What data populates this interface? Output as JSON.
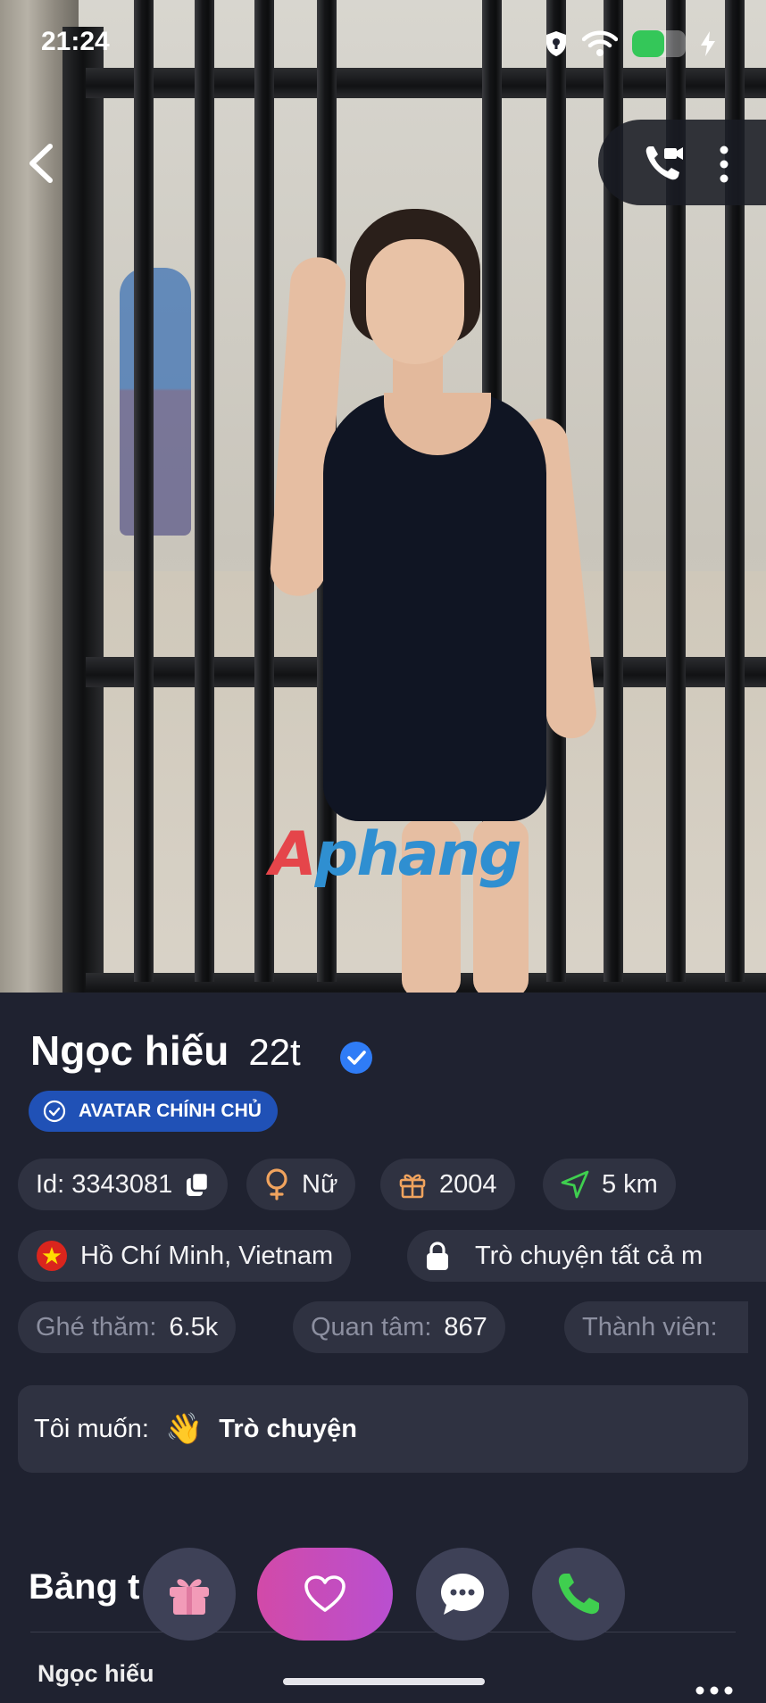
{
  "status_bar": {
    "time": "21:24",
    "battery_level": 0.6
  },
  "photo": {
    "watermark_part1": "A",
    "watermark_part2": "phang"
  },
  "profile": {
    "name": "Ngọc hiếu",
    "age": "22t",
    "badge_label": "AVATAR CHÍNH CHỦ"
  },
  "chips": {
    "id_label": "Id: 3343081",
    "gender": "Nữ",
    "birth_year": "2004",
    "distance": "5 km",
    "location": "Hồ Chí Minh, Vietnam",
    "chat_setting": "Trò chuyện tất cả m"
  },
  "stats": {
    "visits_label": "Ghé thăm:",
    "visits_value": "6.5k",
    "interest_label": "Quan tâm:",
    "interest_value": "867",
    "members_label": "Thành viên:"
  },
  "want": {
    "label": "Tôi muốn:",
    "emoji": "👋",
    "value": "Trò chuyện"
  },
  "section": {
    "title": "Bảng t",
    "sub_name": "Ngọc hiếu"
  },
  "colors": {
    "background": "#1f2230",
    "chip": "#2f3241",
    "badge": "#2051b6",
    "like_gradient_start": "#d24aa8",
    "like_gradient_end": "#b94fd0",
    "call_green": "#3fcf4f",
    "gift_pink": "#f29bb8"
  }
}
